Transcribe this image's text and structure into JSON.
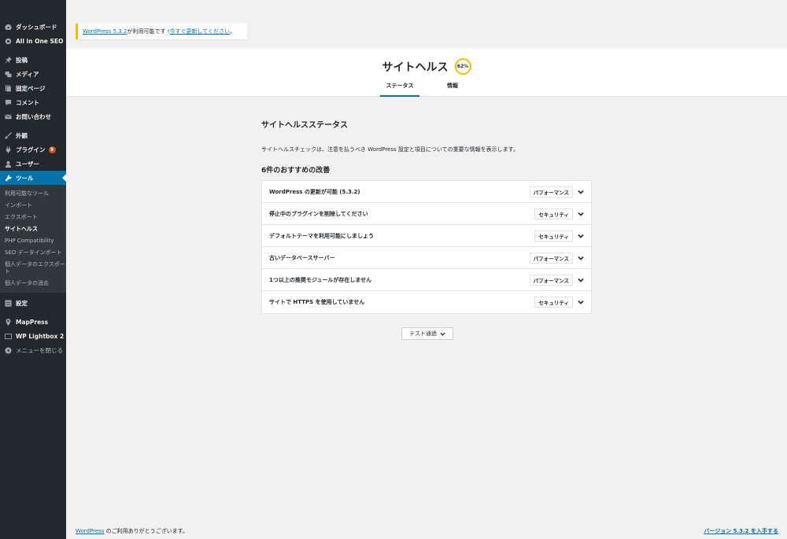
{
  "sidebar": {
    "items": [
      {
        "label": "ダッシュボード",
        "icon": "dashboard-icon"
      },
      {
        "label": "All in One SEO",
        "icon": "gear-icon"
      },
      {
        "label": "投稿",
        "icon": "pin-icon"
      },
      {
        "label": "メディア",
        "icon": "media-icon"
      },
      {
        "label": "固定ページ",
        "icon": "page-icon"
      },
      {
        "label": "コメント",
        "icon": "comment-icon"
      },
      {
        "label": "お問い合わせ",
        "icon": "mail-icon"
      },
      {
        "label": "外観",
        "icon": "brush-icon"
      },
      {
        "label": "プラグイン",
        "icon": "plugin-icon",
        "badge": "9"
      },
      {
        "label": "ユーザー",
        "icon": "user-icon"
      },
      {
        "label": "ツール",
        "icon": "wrench-icon"
      }
    ],
    "submenu": [
      "利用可能なツール",
      "インポート",
      "エクスポート",
      "サイトヘルス",
      "PHP Compatibility",
      "SEO データインポート",
      "個人データのエクスポート",
      "個人データの消去"
    ],
    "settings_label": "設定",
    "mappress_label": "MapPress",
    "lightbox_label": "WP Lightbox 2",
    "collapse_label": "メニューを閉じる"
  },
  "notice": {
    "link_version": "WordPress 5.3.2",
    "text": " が利用可能です ! ",
    "link_update": "今すぐ更新してください",
    "end": "。"
  },
  "header": {
    "title": "サイトヘルス",
    "score": "62%",
    "tab_status": "ステータス",
    "tab_info": "情報"
  },
  "main": {
    "section_title": "サイトヘルスステータス",
    "description": "サイトヘルスチェックは、注意を払うべき WordPress 設定と項目についての重要な情報を表示します。",
    "recommended_heading": "6件のおすすめの改善",
    "issues": [
      {
        "label": "WordPress の更新が可能 (5.3.2)",
        "badge": "パフォーマンス"
      },
      {
        "label": "停止中のプラグインを削除してください",
        "badge": "セキュリティ"
      },
      {
        "label": "デフォルトテーマを利用可能にしましょう",
        "badge": "セキュリティ"
      },
      {
        "label": "古いデータベースサーバー",
        "badge": "パフォーマンス"
      },
      {
        "label": "1つ以上の推奨モジュールが存在しません",
        "badge": "パフォーマンス"
      },
      {
        "label": "サイトで HTTPS を使用していません",
        "badge": "セキュリティ"
      }
    ],
    "passed_button": "テスト通過"
  },
  "footer": {
    "left_link": "WordPress",
    "left_text": " のご利用ありがとうございます。",
    "right_link": "バージョン 5.3.2 を入手する"
  },
  "colors": {
    "sidebar_bg": "#23282d",
    "accent": "#0073aa",
    "warning": "#ffb900",
    "badge": "#d54e21"
  }
}
